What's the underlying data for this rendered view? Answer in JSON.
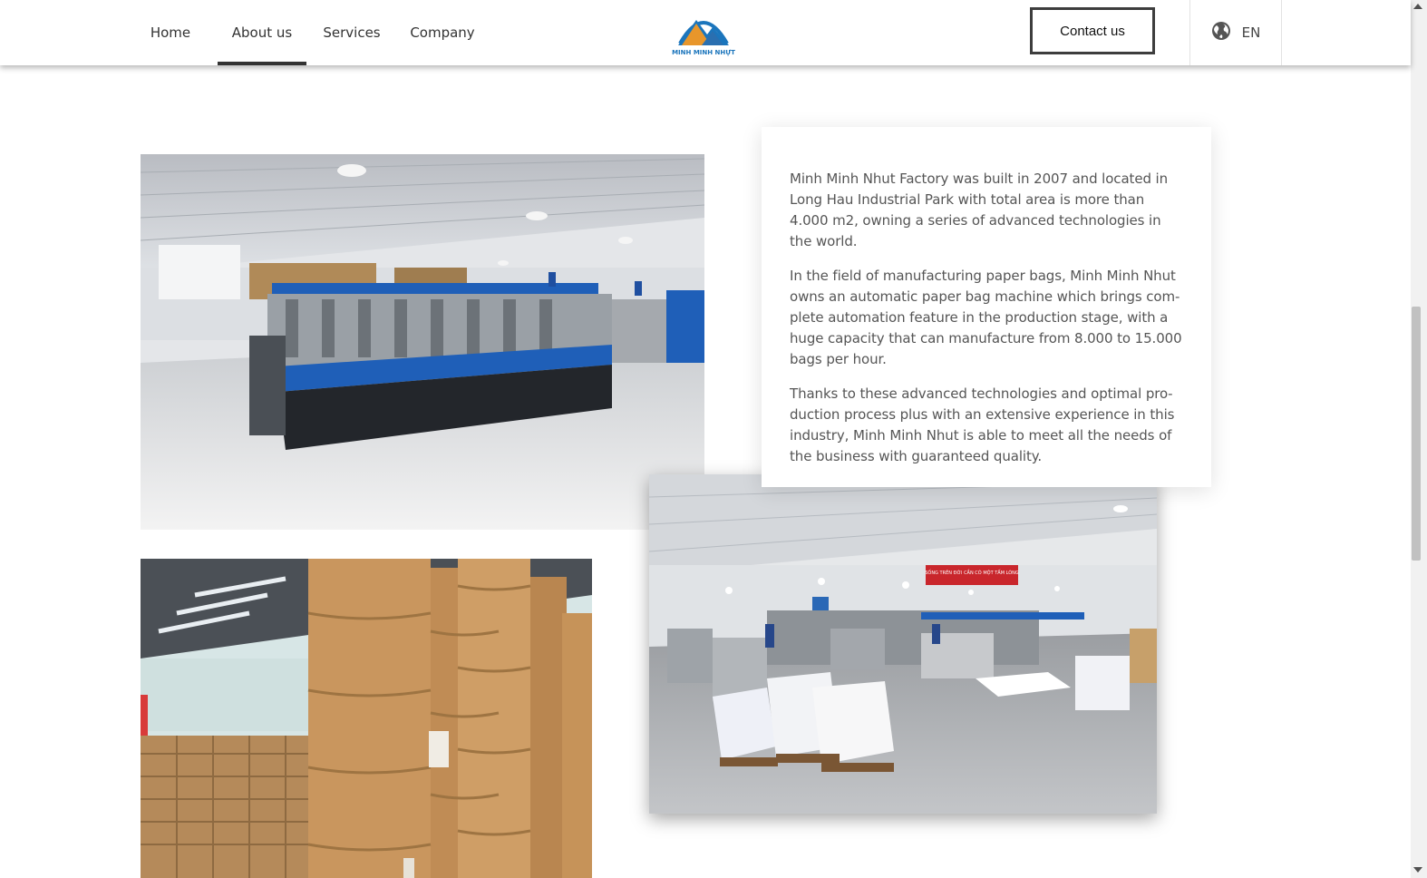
{
  "nav": {
    "items": [
      {
        "label": "Home"
      },
      {
        "label": "About us"
      },
      {
        "label": "Services"
      },
      {
        "label": "Company"
      }
    ],
    "active": "About us",
    "logo_text": "MINH MINH NHỰT",
    "contact_label": "Contact us",
    "language": "EN"
  },
  "content": {
    "paragraphs": [
      "Minh Minh Nhut Factory was built in 2007 and located in Long Hau Industrial Park with total area is more than 4.000 m2, owning a series of advanced technologies in the world.",
      "In the field of manufacturing paper bags, Minh Minh Nhut owns an automatic paper bag machine which brings com­plete automation feature in the production stage, with a huge capacity that can manufacture from 8.000 to 15.000 bags per hour.",
      "Thanks to these advanced technologies and optimal pro­duction process plus with an extensive experience in this industry, Minh Minh Nhut is able to meet all the needs of the business with guaranteed quality."
    ],
    "banner_text": "SỐNG TRÊN ĐỜI CẦN CÓ MỘT TẤM LÒNG"
  },
  "colors": {
    "logo_orange": "#e8962b",
    "logo_blue": "#1b75bc",
    "machine_blue": "#1f5fb8",
    "cardboard": "#c9965e"
  }
}
